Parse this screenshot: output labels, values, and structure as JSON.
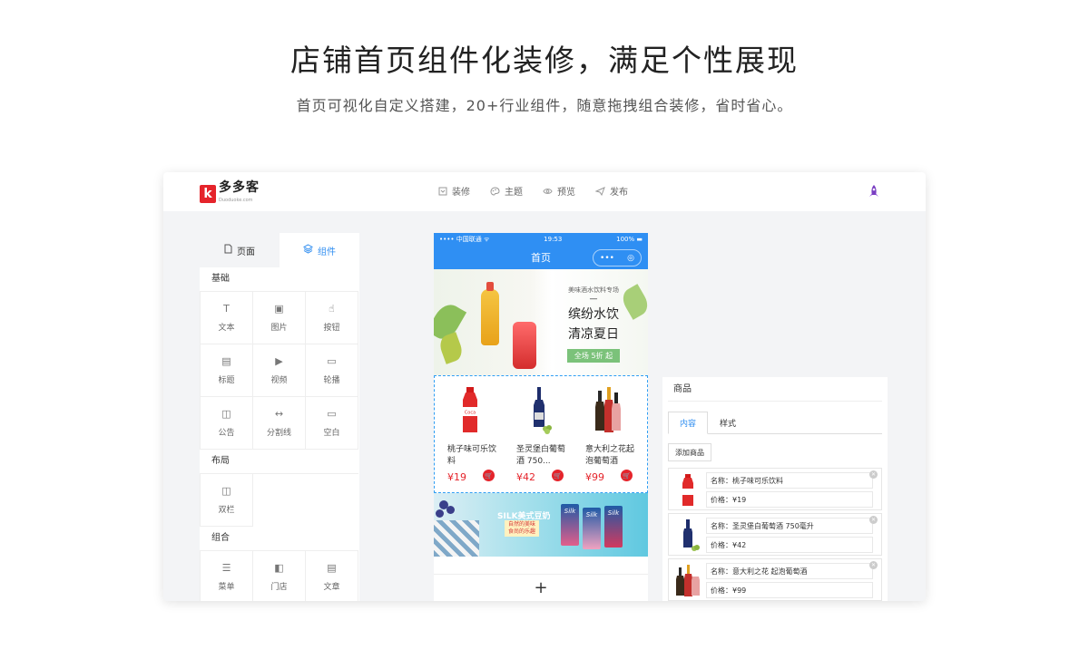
{
  "hero": {
    "title": "店铺首页组件化装修，满足个性展现",
    "subtitle": "首页可视化自定义搭建，20+行业组件，随意拖拽组合装修，省时省心。"
  },
  "brand": {
    "logo_letter": "k",
    "name": "多多客",
    "tagline": "Duoduoke.com"
  },
  "nav": [
    {
      "label": "装修",
      "icon": "decorate-icon"
    },
    {
      "label": "主题",
      "icon": "palette-icon"
    },
    {
      "label": "预览",
      "icon": "eye-icon"
    },
    {
      "label": "发布",
      "icon": "send-icon"
    }
  ],
  "left_panel": {
    "tabs": [
      {
        "label": "页面",
        "icon": "page-icon"
      },
      {
        "label": "组件",
        "icon": "layers-icon"
      }
    ],
    "sections": [
      {
        "title": "基础",
        "items": [
          {
            "label": "文本",
            "glyph": "T"
          },
          {
            "label": "图片",
            "glyph": "▣"
          },
          {
            "label": "按钮",
            "glyph": "☝"
          },
          {
            "label": "标题",
            "glyph": "▤"
          },
          {
            "label": "视频",
            "glyph": "▶"
          },
          {
            "label": "轮播",
            "glyph": "▭"
          },
          {
            "label": "公告",
            "glyph": "◫"
          },
          {
            "label": "分割线",
            "glyph": "↔"
          },
          {
            "label": "空白",
            "glyph": "▭"
          }
        ]
      },
      {
        "title": "布局",
        "items": [
          {
            "label": "双栏",
            "glyph": "◫"
          }
        ]
      },
      {
        "title": "组合",
        "items": [
          {
            "label": "菜单",
            "glyph": "☰"
          },
          {
            "label": "门店",
            "glyph": "◧"
          },
          {
            "label": "文章",
            "glyph": "▤"
          }
        ]
      }
    ]
  },
  "phone": {
    "carrier": "•••• 中国联通 ᯤ",
    "time": "19:53",
    "battery": "100% ▬",
    "title": "首页",
    "capsule_more": "•••",
    "capsule_target": "◎",
    "banner": {
      "small": "美味酒水饮料专场",
      "dash": "—",
      "line1": "缤纷水饮",
      "line2": "清凉夏日",
      "tag": "全场 5折 起"
    },
    "products": [
      {
        "name": "桃子味可乐饮料",
        "price": "¥19"
      },
      {
        "name": "圣灵堡白葡萄酒 750...",
        "price": "¥42"
      },
      {
        "name": "意大利之花起泡葡萄酒",
        "price": "¥99"
      }
    ],
    "banner2": {
      "title": "SILK美式豆奶",
      "sub1": "自然的美味",
      "sub2": "食尚的乐趣",
      "box_label": "Silk"
    },
    "add_label": "+"
  },
  "right_panel": {
    "title": "商品",
    "tabs": [
      "内容",
      "样式"
    ],
    "add_button": "添加商品",
    "items": [
      {
        "name": "名称：桃子味可乐饮料",
        "price": "价格：¥19"
      },
      {
        "name": "名称：圣灵堡白葡萄酒 750毫升",
        "price": "价格：¥42"
      },
      {
        "name": "名称：意大利之花 起泡葡萄酒",
        "price": "价格：¥99"
      }
    ]
  },
  "colors": {
    "accent": "#2f8df0",
    "brand_red": "#e5242b",
    "phone_header": "#2f8ff3"
  }
}
